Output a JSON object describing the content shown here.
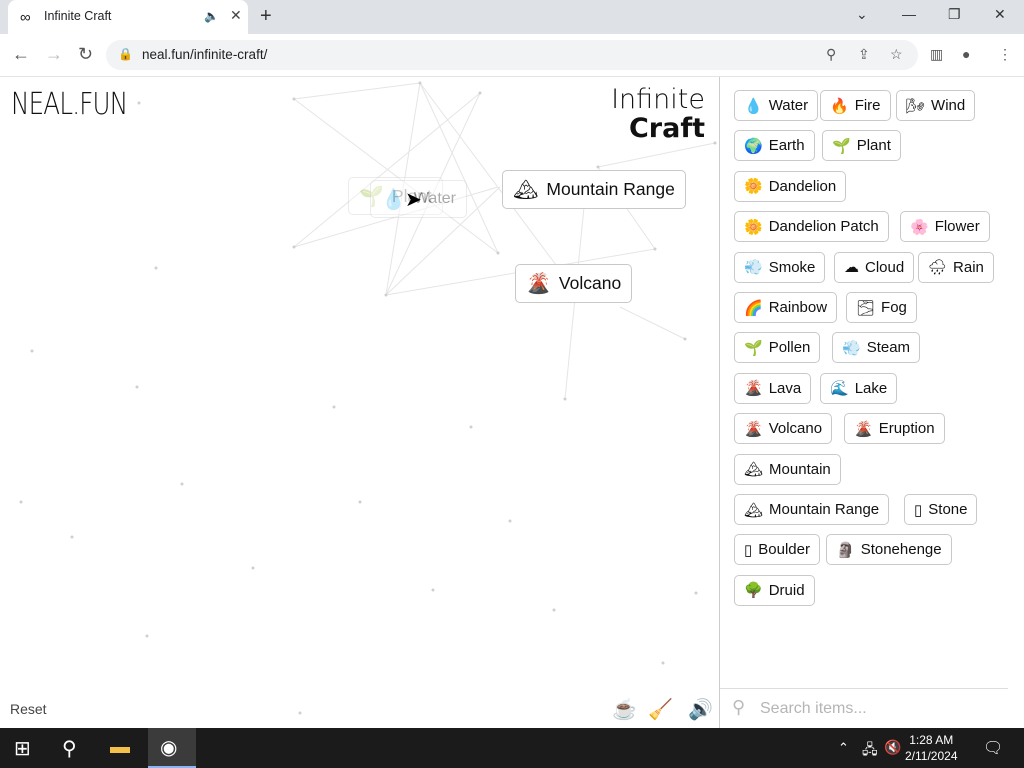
{
  "browser": {
    "tab_title": "Infinite Craft",
    "tab_favicon": "∞",
    "speaker_icon": "🔈",
    "tab_close": "✕",
    "new_tab": "+",
    "url": "neal.fun/infinite-craft/",
    "window_controls": {
      "menu": "⌄",
      "minimize": "—",
      "restore": "❐",
      "close": "✕"
    }
  },
  "game": {
    "logo": "NEAL.FUN",
    "brand_line1": "Infinite",
    "brand_line2": "Craft",
    "reset_label": "Reset",
    "canvas_items": [
      {
        "name": "Mountain Range",
        "emoji": "🏔"
      },
      {
        "name": "Volcano",
        "emoji": "🌋"
      },
      {
        "name": "Plant",
        "emoji": "🌱"
      },
      {
        "name": "Water",
        "emoji": "💧"
      }
    ]
  },
  "sidebar": {
    "items": [
      {
        "name": "Water",
        "emoji": "💧"
      },
      {
        "name": "Fire",
        "emoji": "🔥"
      },
      {
        "name": "Wind",
        "emoji": "🌬"
      },
      {
        "name": "Earth",
        "emoji": "🌍"
      },
      {
        "name": "Plant",
        "emoji": "🌱"
      },
      {
        "name": "Dandelion",
        "emoji": "🌼"
      },
      {
        "name": "Dandelion Patch",
        "emoji": "🌼"
      },
      {
        "name": "Flower",
        "emoji": "🌸"
      },
      {
        "name": "Smoke",
        "emoji": "💨"
      },
      {
        "name": "Cloud",
        "emoji": "☁"
      },
      {
        "name": "Rain",
        "emoji": "🌧"
      },
      {
        "name": "Rainbow",
        "emoji": "🌈"
      },
      {
        "name": "Fog",
        "emoji": "🌫"
      },
      {
        "name": "Pollen",
        "emoji": "🌱"
      },
      {
        "name": "Steam",
        "emoji": "💨"
      },
      {
        "name": "Lava",
        "emoji": "🌋"
      },
      {
        "name": "Lake",
        "emoji": "🌊"
      },
      {
        "name": "Volcano",
        "emoji": "🌋"
      },
      {
        "name": "Eruption",
        "emoji": "🌋"
      },
      {
        "name": "Mountain",
        "emoji": "🏔"
      },
      {
        "name": "Mountain Range",
        "emoji": "🏔"
      },
      {
        "name": "Stone",
        "emoji": "▯"
      },
      {
        "name": "Boulder",
        "emoji": "▯"
      },
      {
        "name": "Stonehenge",
        "emoji": "🗿"
      },
      {
        "name": "Druid",
        "emoji": "🌳"
      }
    ],
    "search_placeholder": "Search items..."
  },
  "taskbar": {
    "time": "1:28 AM",
    "date": "2/11/2024"
  }
}
